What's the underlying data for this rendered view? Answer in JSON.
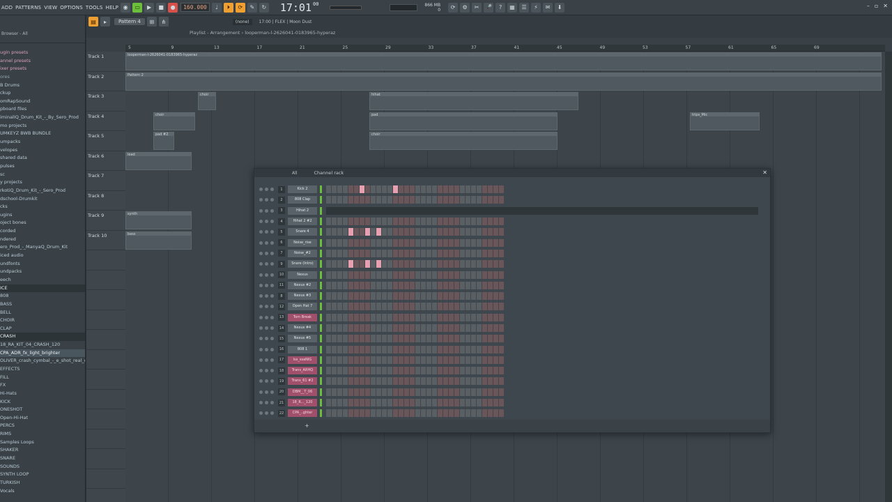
{
  "menu": [
    "ADD",
    "PATTERNS",
    "VIEW",
    "OPTIONS",
    "TOOLS",
    "HELP"
  ],
  "transport": {
    "bpm": "160.000",
    "time": "17:01",
    "time_sub": "00",
    "cpu_mem": "866 MB",
    "cpu_val": "0"
  },
  "toolbar2": {
    "pattern": "Pattern 4",
    "snap": "(none)",
    "hint": "17:00 | FLEX | Moon Dust"
  },
  "browser": {
    "header": "Browser - All",
    "items": [
      {
        "label": "ugin presets",
        "style": "pink"
      },
      {
        "label": "annel presets",
        "style": "pink"
      },
      {
        "label": "ixer presets",
        "style": "pink"
      },
      {
        "label": "ores",
        "style": "dim"
      },
      {
        "label": "B Drums",
        "style": ""
      },
      {
        "label": "ckup",
        "style": ""
      },
      {
        "label": "omRapSound",
        "style": ""
      },
      {
        "label": "pboard files",
        "style": ""
      },
      {
        "label": "iminalIQ_Drum_Kit_-_By_Sero_Prod",
        "style": ""
      },
      {
        "label": "mo projects",
        "style": ""
      },
      {
        "label": "UMKEYZ BWB BUNDLE",
        "style": ""
      },
      {
        "label": "umpacks",
        "style": ""
      },
      {
        "label": "velopes",
        "style": ""
      },
      {
        "label": "shared data",
        "style": ""
      },
      {
        "label": "pulses",
        "style": ""
      },
      {
        "label": "sc",
        "style": ""
      },
      {
        "label": "y projects",
        "style": ""
      },
      {
        "label": "rkotiQ_Drum_Kit_-_Sero_Prod",
        "style": ""
      },
      {
        "label": "dschool-Drumkit",
        "style": ""
      },
      {
        "label": "cks",
        "style": ""
      },
      {
        "label": "ugins",
        "style": ""
      },
      {
        "label": "oject bones",
        "style": ""
      },
      {
        "label": "corded",
        "style": ""
      },
      {
        "label": "ndered",
        "style": ""
      },
      {
        "label": "ero_Prod_-_ManyaQ_Drum_Kit",
        "style": ""
      },
      {
        "label": "iced audio",
        "style": ""
      },
      {
        "label": "undfonts",
        "style": ""
      },
      {
        "label": "undpacks",
        "style": ""
      },
      {
        "label": "eech",
        "style": ""
      },
      {
        "label": "ICE",
        "style": "sel"
      },
      {
        "label": "808",
        "style": ""
      },
      {
        "label": "BASS",
        "style": ""
      },
      {
        "label": "BELL",
        "style": ""
      },
      {
        "label": "CHOIR",
        "style": ""
      },
      {
        "label": "CLAP",
        "style": ""
      },
      {
        "label": "CRASH",
        "style": "sel"
      },
      {
        "label": "18_RA_KIT_04_CRASH_120",
        "style": ""
      },
      {
        "label": "CPA_ADR_fx_light_brighter",
        "style": "sel-light"
      },
      {
        "label": "OLIVER_crash_cymbal_-_e_shot_real_clean_07",
        "style": ""
      },
      {
        "label": "EFFECTS",
        "style": ""
      },
      {
        "label": "FILL",
        "style": ""
      },
      {
        "label": "FX",
        "style": ""
      },
      {
        "label": "Hi-Hats",
        "style": ""
      },
      {
        "label": "KICK",
        "style": ""
      },
      {
        "label": "ONESHOT",
        "style": ""
      },
      {
        "label": "Open-Hi-Hat",
        "style": ""
      },
      {
        "label": "PERCS",
        "style": ""
      },
      {
        "label": "RIMS",
        "style": ""
      },
      {
        "label": "Samples Loops",
        "style": ""
      },
      {
        "label": "SHAKER",
        "style": ""
      },
      {
        "label": "SNARE",
        "style": ""
      },
      {
        "label": "SOUNDS",
        "style": ""
      },
      {
        "label": "SYNTH LOOP",
        "style": ""
      },
      {
        "label": "TURKISH",
        "style": ""
      },
      {
        "label": "Vocals",
        "style": ""
      }
    ]
  },
  "playlist": {
    "title": "Playlist - Arrangement › looperman-l-2626041-0183965-hyperaz",
    "ruler": [
      "5",
      "9",
      "13",
      "17",
      "21",
      "25",
      "29",
      "33",
      "37",
      "41",
      "45",
      "49",
      "53",
      "57",
      "61",
      "65",
      "69"
    ],
    "tracks": [
      "Track 1",
      "Track 2",
      "Track 3",
      "Track 4",
      "Track 5",
      "Track 6",
      "Track 7",
      "Track 8",
      "Track 9",
      "Track 10"
    ],
    "clips": [
      {
        "track": 0,
        "start": 0,
        "end": 1085,
        "label": "looperman-l-2626041-0183965-hyperaz"
      },
      {
        "track": 1,
        "start": 0,
        "end": 1085,
        "label": "Pattern 2"
      },
      {
        "track": 2,
        "start": 104,
        "end": 130,
        "label": "choir"
      },
      {
        "track": 2,
        "start": 350,
        "end": 650,
        "label": "hihat"
      },
      {
        "track": 3,
        "start": 40,
        "end": 100,
        "label": "choir"
      },
      {
        "track": 3,
        "start": 350,
        "end": 620,
        "label": "pad"
      },
      {
        "track": 3,
        "start": 810,
        "end": 910,
        "label": "trips_Mic"
      },
      {
        "track": 4,
        "start": 40,
        "end": 70,
        "label": "pad #2"
      },
      {
        "track": 4,
        "start": 350,
        "end": 620,
        "label": "choir"
      },
      {
        "track": 5,
        "start": 0,
        "end": 95,
        "label": "lead"
      },
      {
        "track": 8,
        "start": 0,
        "end": 95,
        "label": "synth"
      },
      {
        "track": 9,
        "start": 0,
        "end": 95,
        "label": "bass"
      }
    ]
  },
  "channel_rack": {
    "title": "Channel rack",
    "filter": "All",
    "add_label": "+",
    "channels": [
      {
        "num": "1",
        "name": "Kick 2",
        "pink": false,
        "on": [
          6,
          12
        ]
      },
      {
        "num": "2",
        "name": "808 Clap",
        "pink": false,
        "on": []
      },
      {
        "num": "3",
        "name": "Hihat 2",
        "pink": false,
        "roll": true,
        "on": []
      },
      {
        "num": "4",
        "name": "Hihat 2 #2",
        "pink": false,
        "on": []
      },
      {
        "num": "5",
        "name": "Snare 4",
        "pink": false,
        "on": [
          4,
          7,
          9
        ]
      },
      {
        "num": "6",
        "name": "Noise_rise",
        "pink": false,
        "on": []
      },
      {
        "num": "7",
        "name": "Noise_#2",
        "pink": false,
        "on": []
      },
      {
        "num": "9",
        "name": "Snare (Intro)",
        "pink": false,
        "on": [
          4,
          7,
          9
        ]
      },
      {
        "num": "10",
        "name": "Nexus",
        "pink": false,
        "on": []
      },
      {
        "num": "11",
        "name": "Nexus #2",
        "pink": false,
        "on": []
      },
      {
        "num": "8",
        "name": "Nexus #3",
        "pink": false,
        "on": []
      },
      {
        "num": "12",
        "name": "Open Hat 7",
        "pink": false,
        "on": []
      },
      {
        "num": "13",
        "name": "Tom Break",
        "pink": true,
        "on": []
      },
      {
        "num": "14",
        "name": "Nexus #4",
        "pink": false,
        "on": []
      },
      {
        "num": "15",
        "name": "Nexus #5",
        "pink": false,
        "on": []
      },
      {
        "num": "16",
        "name": "808 1",
        "pink": false,
        "on": []
      },
      {
        "num": "17",
        "name": "lss_ssaNIG",
        "pink": true,
        "on": []
      },
      {
        "num": "18",
        "name": "Trans_ARHQ",
        "pink": true,
        "on": []
      },
      {
        "num": "19",
        "name": "Trans_61 #2",
        "pink": true,
        "on": []
      },
      {
        "num": "20",
        "name": "DBM__T_06",
        "pink": true,
        "on": []
      },
      {
        "num": "21",
        "name": "18_R..._120",
        "pink": true,
        "on": []
      },
      {
        "num": "22",
        "name": "CPA_..ghter",
        "pink": true,
        "on": []
      }
    ]
  },
  "colors": {
    "accent_green": "#6bbf3a",
    "accent_orange": "#f0a030",
    "step_on": "#e8a0b0"
  }
}
